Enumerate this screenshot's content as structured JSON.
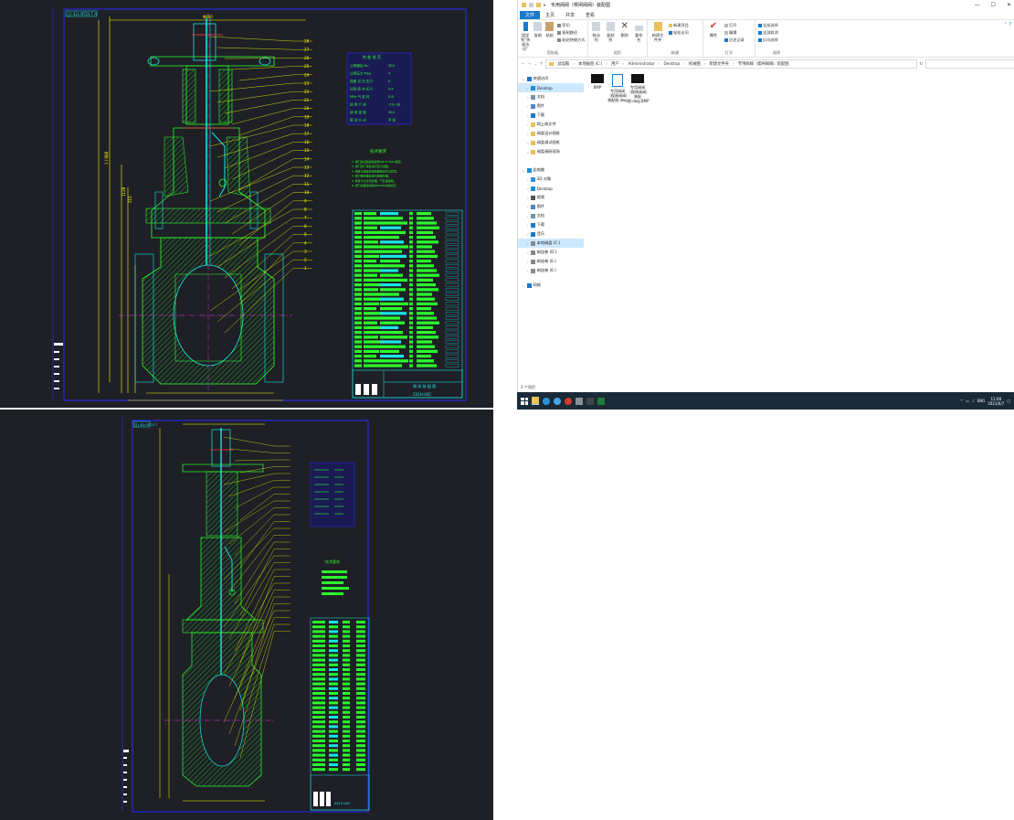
{
  "top_drawing": {
    "stamp": "日) 42c.RT23 T  A",
    "top_dim": "Φ800",
    "height_dim": "1 / 闸阀",
    "dims_left": [
      "1128",
      "215"
    ],
    "spec_title": "性 能 规 范",
    "spec_rows": [
      [
        "公称通径  Dn",
        "300"
      ],
      [
        "公称压力  Mpa",
        "4"
      ],
      [
        "强度  试  压  压力",
        "6"
      ],
      [
        "试验  密  封  压力",
        "4.4"
      ],
      [
        "MPa  气  密  封",
        "0.6"
      ],
      [
        "适  用  介  质",
        "-29~38"
      ],
      [
        "适  用  温  度",
        "450"
      ],
      [
        "驱  动  方  式",
        "手  轮"
      ]
    ],
    "tech_title": "技术要求",
    "tech_lines": [
      "1. 阀门的试验和检验按GB/T13927规定。",
      "2. 阀门出厂前应进行压力试验。",
      "3. 阀体与阀盖的连接螺栓应均匀拧紧。",
      "4. 阀门密封面应进行研磨处理。",
      "5. 铸件不允许有砂眼、气孔等缺陷。",
      "6. 阀门表面涂漆按JB/T106标准执行。"
    ],
    "title_block": "闸 阀 装 配 图",
    "drawing_no": "Z41H-40C",
    "part_numbers": [
      "1",
      "2",
      "3",
      "4",
      "5",
      "6",
      "7",
      "8",
      "9",
      "10",
      "11",
      "12",
      "13",
      "14",
      "15",
      "16",
      "17",
      "18",
      "19",
      "20",
      "21",
      "22",
      "23",
      "24",
      "25",
      "26",
      "27",
      "28"
    ]
  },
  "bottom_drawing": {
    "stamp": "日) 42c.RT23 T",
    "tech_title": "技术要求",
    "drawing_no": "Z41H-40C"
  },
  "explorer": {
    "title": "专用阀阀（楔闸阀阀）装配图",
    "tabs": [
      "文件",
      "主页",
      "共享",
      "查看"
    ],
    "active_tab": "文件",
    "ribbon": {
      "clipboard": {
        "pin": "固定到\"快速访问\"",
        "copy": "复制",
        "paste": "粘贴",
        "cut": "剪切",
        "copy_path": "复制路径",
        "paste_shortcut": "粘贴快捷方式",
        "group": "剪贴板"
      },
      "organize": {
        "move_to": "移动到",
        "copy_to": "复制到",
        "delete": "删除",
        "rename": "重命名",
        "group": "组织"
      },
      "new": {
        "new_folder": "新建文件夹",
        "new_item": "新建项目",
        "easy_access": "轻松访问",
        "group": "新建"
      },
      "open": {
        "properties": "属性",
        "open": "打开",
        "edit": "编辑",
        "history": "历史记录",
        "group": "打开"
      },
      "select": {
        "select_all": "全部选择",
        "select_none": "全部取消",
        "invert": "反向选择",
        "group": "选择"
      }
    },
    "breadcrumb": [
      "此电脑",
      "本地磁盘 (C:)",
      "用户",
      "Administrator",
      "Desktop",
      "机械图",
      "新建文件夹",
      "专用阀阀（楔闸阀阀）装配图"
    ],
    "nav": [
      {
        "label": "快速访问",
        "icon": "star-icon",
        "color": "#1979ca"
      },
      {
        "label": "Desktop",
        "icon": "desktop-icon",
        "color": "#1a8fd9",
        "selected": true
      },
      {
        "label": "文档",
        "icon": "document-icon",
        "color": "#7a8ea0"
      },
      {
        "label": "图片",
        "icon": "picture-icon",
        "color": "#4f86c6"
      },
      {
        "label": "下载",
        "icon": "download-icon",
        "color": "#1979ca"
      },
      {
        "label": "网上商文件",
        "icon": "folder-icon",
        "color": "#e8c25a"
      },
      {
        "label": "阀类设计图纸",
        "icon": "folder-icon",
        "color": "#e8c25a"
      },
      {
        "label": "阀类调试图纸",
        "icon": "folder-icon",
        "color": "#e8c25a"
      },
      {
        "label": "阀类调研现场",
        "icon": "folder-icon",
        "color": "#e8c25a"
      },
      {
        "label": "此电脑",
        "icon": "computer-icon",
        "color": "#1a8fd9"
      },
      {
        "label": "3D 对象",
        "icon": "cube-icon",
        "color": "#2f8fd6"
      },
      {
        "label": "Desktop",
        "icon": "desktop-icon",
        "color": "#1a8fd9"
      },
      {
        "label": "视频",
        "icon": "video-icon",
        "color": "#555"
      },
      {
        "label": "图片",
        "icon": "picture-icon",
        "color": "#4f86c6"
      },
      {
        "label": "文档",
        "icon": "document-icon",
        "color": "#7a8ea0"
      },
      {
        "label": "下载",
        "icon": "download-icon",
        "color": "#1979ca"
      },
      {
        "label": "音乐",
        "icon": "music-icon",
        "color": "#1979ca"
      },
      {
        "label": "本地磁盘 (C:)",
        "icon": "drive-icon",
        "color": "#888",
        "selected": true
      },
      {
        "label": "新加卷 (D:)",
        "icon": "drive-icon",
        "color": "#888"
      },
      {
        "label": "新加卷 (E:)",
        "icon": "drive-icon",
        "color": "#888"
      },
      {
        "label": "新加卷 (E:)",
        "icon": "drive-icon",
        "color": "#888"
      },
      {
        "label": "网络",
        "icon": "network-icon",
        "color": "#1979ca"
      }
    ],
    "files": [
      {
        "name": "BMP",
        "kind": "folder-thumb"
      },
      {
        "name": "专用阀阀（楔闸阀阀）装配图.dwg",
        "kind": "dwg"
      },
      {
        "name": "专用阀阀（楔闸阀阀）装配图.dwg.BMP",
        "kind": "bmp"
      }
    ],
    "status": "3 个项目"
  },
  "taskbar": {
    "tray_lang": "ENG",
    "time": "11:08",
    "date": "2021/6/7"
  },
  "colors": {
    "cad_bg": "#1e2026",
    "cad_green": "#2bff2b",
    "cad_cyan": "#19e6e6",
    "cad_yellow": "#ffff00",
    "cad_red": "#ff3a3a",
    "cad_magenta": "#ff33ff",
    "cad_blue": "#2a2aff",
    "explorer_blue": "#1979ca",
    "taskbar": "#1b2a37"
  }
}
